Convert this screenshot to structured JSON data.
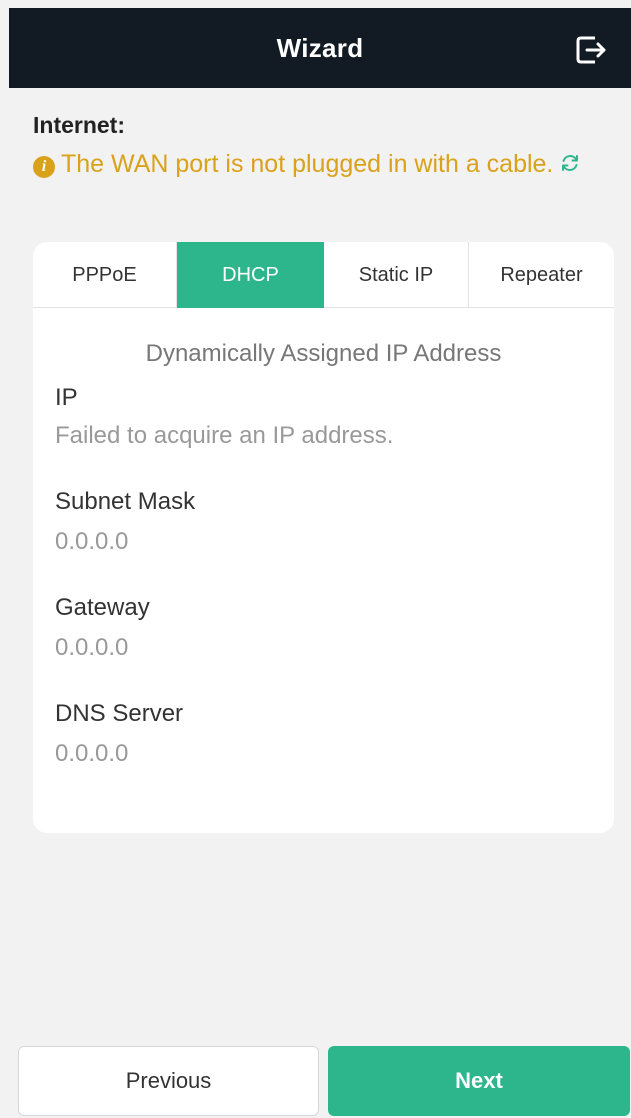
{
  "header": {
    "title": "Wizard",
    "logout_icon": "logout-icon"
  },
  "internet": {
    "label": "Internet:",
    "warning_icon": "info-icon",
    "warning_text": "The WAN port is not plugged in with a cable.",
    "refresh_icon": "refresh-icon",
    "warning_color": "#d9a21a"
  },
  "tabs": [
    {
      "label": "PPPoE",
      "active": false
    },
    {
      "label": "DHCP",
      "active": true
    },
    {
      "label": "Static IP",
      "active": false
    },
    {
      "label": "Repeater",
      "active": false
    }
  ],
  "dhcp": {
    "heading": "Dynamically Assigned IP Address",
    "fields": [
      {
        "label": "IP",
        "value": "Failed to acquire an IP address."
      },
      {
        "label": "Subnet Mask",
        "value": "0.0.0.0"
      },
      {
        "label": "Gateway",
        "value": "0.0.0.0"
      },
      {
        "label": "DNS Server",
        "value": "0.0.0.0"
      }
    ]
  },
  "buttons": {
    "previous": "Previous",
    "next": "Next"
  },
  "colors": {
    "accent": "#2db68c",
    "topbar": "#121a24"
  }
}
